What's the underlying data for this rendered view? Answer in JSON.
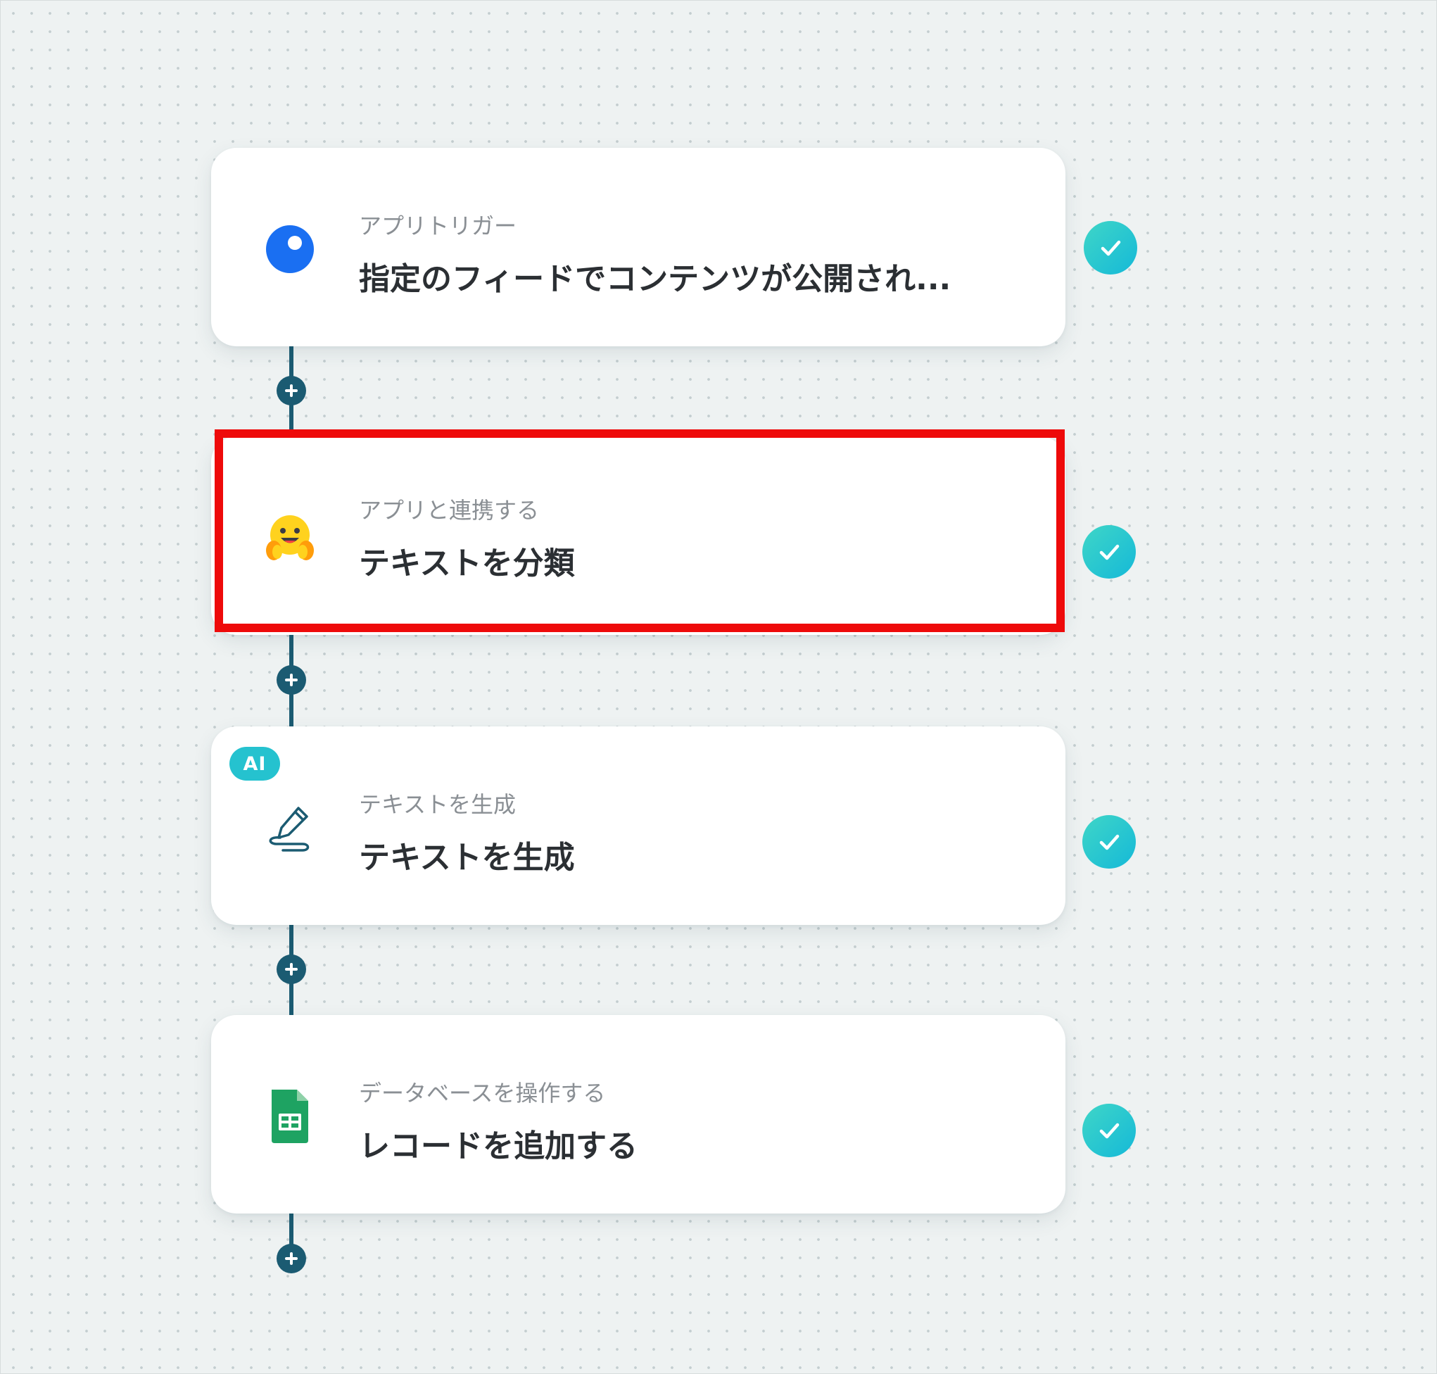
{
  "workflow": {
    "steps": [
      {
        "label": "アプリトリガー",
        "title": "指定のフィードでコンテンツが公開され...",
        "icon": "rss-app-icon",
        "status": "completed"
      },
      {
        "label": "アプリと連携する",
        "title": "テキストを分類",
        "icon": "hugging-face-icon",
        "status": "completed",
        "highlighted": true
      },
      {
        "label": "テキストを生成",
        "title": "テキストを生成",
        "icon": "pen-write-icon",
        "badge": "AI",
        "status": "completed"
      },
      {
        "label": "データベースを操作する",
        "title": "レコードを追加する",
        "icon": "google-sheets-icon",
        "status": "completed"
      }
    ]
  },
  "colors": {
    "connector": "#1b5b72",
    "check_start": "#3fd6c7",
    "check_end": "#15b9d8",
    "highlight": "#ee0a0a",
    "ai_badge": "#25c2cf",
    "sheets_green": "#1ea362"
  }
}
